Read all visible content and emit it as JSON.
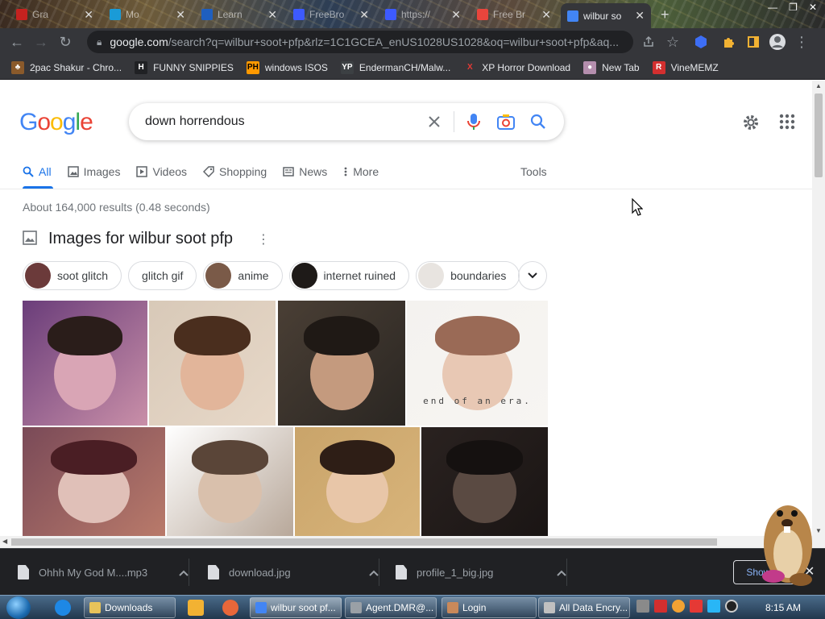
{
  "browser": {
    "tabs": [
      {
        "label": "Gra",
        "favicon_color": "#c5221f"
      },
      {
        "label": "Mo",
        "favicon_color": "#1a9bd7"
      },
      {
        "label": "Learn",
        "favicon_color": "#1f5fbf"
      },
      {
        "label": "FreeBro",
        "favicon_color": "#3d5afe"
      },
      {
        "label": "https://",
        "favicon_color": "#3d5afe"
      },
      {
        "label": "Free Br",
        "favicon_color": "#e8453c"
      },
      {
        "label": "wilbur so",
        "favicon_color": "#4285f4",
        "active": true
      }
    ],
    "url_domain": "google.com",
    "url_rest": "/search?q=wilbur+soot+pfp&rlz=1C1GCEA_enUS1028US1028&oq=wilbur+soot+pfp&aq...",
    "bookmarks": [
      {
        "label": "2pac Shakur - Chro...",
        "icon_text": "♣",
        "icon_color": "#8a5a2b",
        "icon_text_color": "#fff"
      },
      {
        "label": "FUNNY SNIPPIES",
        "icon_text": "H",
        "icon_color": "#202124",
        "icon_text_color": "#fff"
      },
      {
        "label": "windows ISOS",
        "icon_text": "PH",
        "icon_color": "#ff9900",
        "icon_text_color": "#000"
      },
      {
        "label": "EndermanCH/Malw...",
        "icon_text": "YP",
        "icon_color": "#3c4043",
        "icon_text_color": "#fff"
      },
      {
        "label": "XP Horror Download",
        "icon_text": "X",
        "icon_color": "#35363a",
        "icon_text_color": "#e53935"
      },
      {
        "label": "New Tab",
        "icon_text": "●",
        "icon_color": "#b48ead",
        "icon_text_color": "#fff"
      },
      {
        "label": "VineMEMZ",
        "icon_text": "R",
        "icon_color": "#d32f2f",
        "icon_text_color": "#fff"
      }
    ]
  },
  "google": {
    "logo_letters": [
      {
        "ch": "G",
        "color": "#4285f4"
      },
      {
        "ch": "o",
        "color": "#ea4335"
      },
      {
        "ch": "o",
        "color": "#fbbc05"
      },
      {
        "ch": "g",
        "color": "#4285f4"
      },
      {
        "ch": "l",
        "color": "#34a853"
      },
      {
        "ch": "e",
        "color": "#ea4335"
      }
    ],
    "search_query": "down horrendous",
    "tabs": [
      {
        "label": "All",
        "icon": "search-icon",
        "active": true
      },
      {
        "label": "Images",
        "icon": "image-icon"
      },
      {
        "label": "Videos",
        "icon": "play-icon"
      },
      {
        "label": "Shopping",
        "icon": "tag-icon"
      },
      {
        "label": "News",
        "icon": "news-icon"
      },
      {
        "label": "More",
        "icon": "kebab-icon"
      }
    ],
    "tools_label": "Tools",
    "result_stats": "About 164,000 results (0.48 seconds)",
    "images_heading": "Images for wilbur soot pfp",
    "chips": [
      {
        "label": "soot glitch",
        "thumb_color": "#6b3a3a"
      },
      {
        "label": "glitch gif"
      },
      {
        "label": "anime",
        "thumb_color": "#7a5a48"
      },
      {
        "label": "internet ruined",
        "thumb_color": "#1e1a18"
      },
      {
        "label": "boundaries",
        "thumb_color": "#e8e4e0"
      }
    ],
    "images": [
      {
        "bg": "#6a3d7a",
        "accent": "#c98fa8",
        "hair": "#2a1d1a",
        "face": "#d9a5b5"
      },
      {
        "bg": "#d8c9b8",
        "accent": "#e7d8c8",
        "hair": "#4a2e1e",
        "face": "#e2b59a"
      },
      {
        "bg": "#4a3f35",
        "accent": "#2a2622",
        "hair": "#1f1915",
        "face": "#c49a7e"
      },
      {
        "bg": "#f4f2ef",
        "accent": "#f7f5f2",
        "hair": "#9a6a56",
        "face": "#e8c8b4",
        "caption": "end of an era."
      },
      {
        "bg": "#7a4a58",
        "accent": "#b97a6a",
        "hair": "#4a1e24",
        "face": "#e0c0b8"
      },
      {
        "bg": "#ffffff",
        "accent": "#b8a89a",
        "hair": "#5a4538",
        "face": "#d9c0ac"
      },
      {
        "bg": "#c9a46a",
        "accent": "#d8b47a",
        "hair": "#2e1e16",
        "face": "#e8c6a8"
      },
      {
        "bg": "#2a2220",
        "accent": "#1a1514",
        "hair": "#151110",
        "face": "#5a4a42"
      }
    ]
  },
  "downloads": [
    {
      "filename": "Ohhh My God M....mp3"
    },
    {
      "filename": "download.jpg"
    },
    {
      "filename": "profile_1_big.jpg"
    }
  ],
  "downloads_show_all": "Show all",
  "taskbar": {
    "buttons": [
      {
        "label": "Downloads",
        "icon_color": "#e8c35a"
      },
      {
        "label": "wilbur soot pf...",
        "icon_color": "#4285f4",
        "active": true
      },
      {
        "label": "Agent.DMR@...",
        "icon_color": "#9aa0a6"
      },
      {
        "label": "Login",
        "icon_color": "#c9895a"
      },
      {
        "label": "All Data Encry...",
        "icon_color": "#c0c0c0"
      }
    ],
    "clock": "8:15 AM"
  }
}
